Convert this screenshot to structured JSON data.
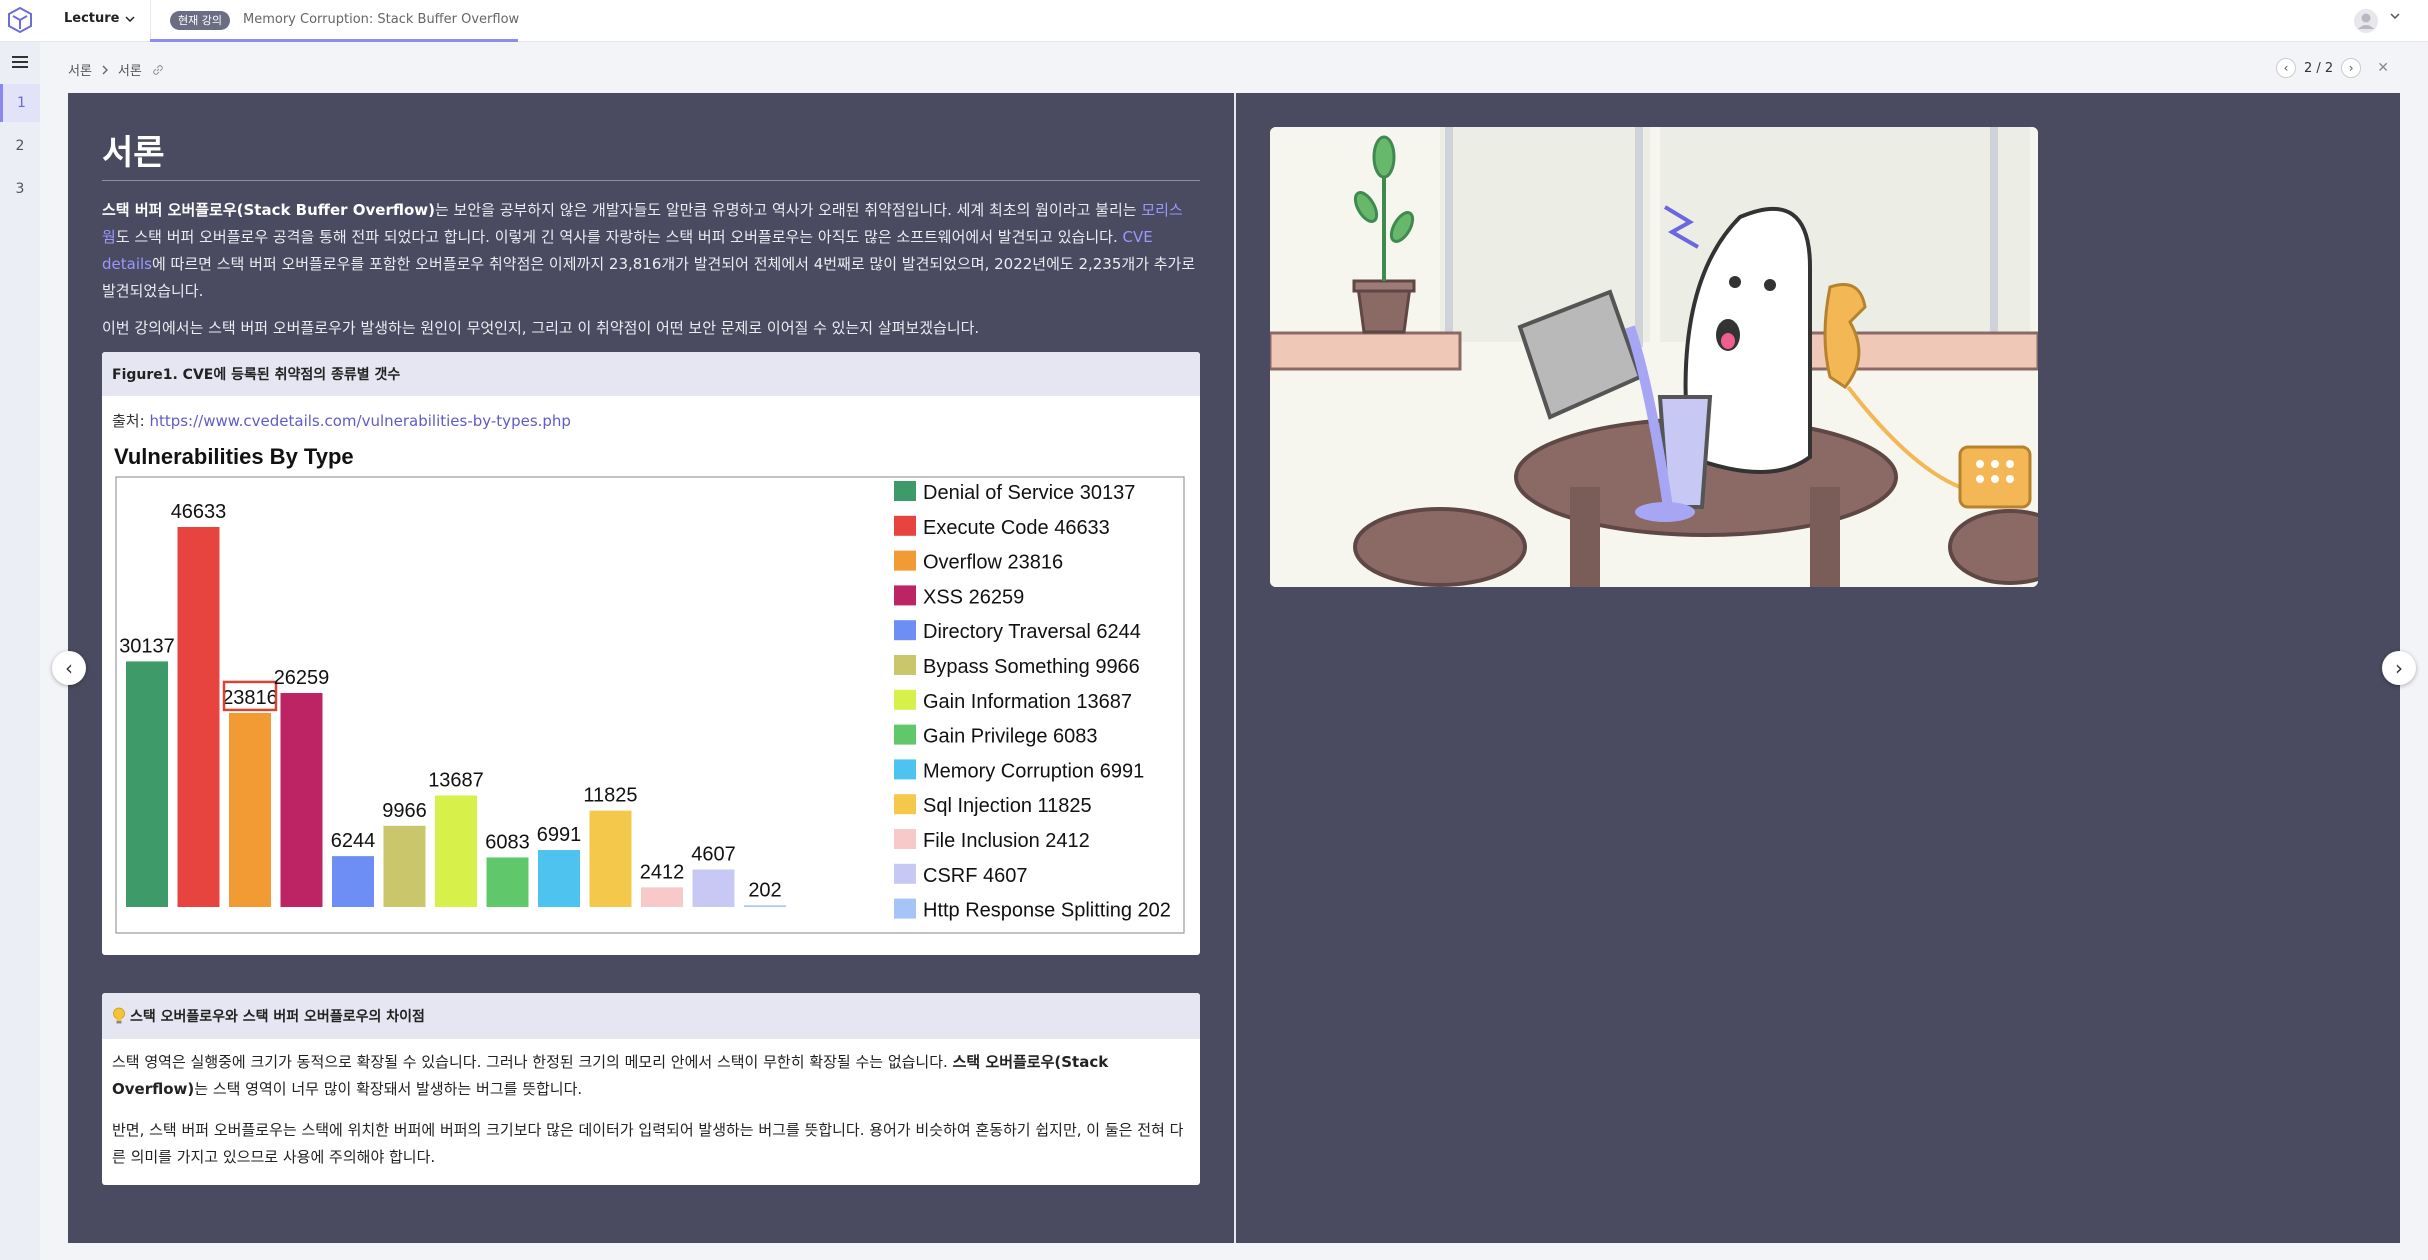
{
  "topbar": {
    "lecture_label": "Lecture",
    "current_badge": "현재 강의",
    "current_title": "Memory Corruption: Stack Buffer Overflow"
  },
  "rail": {
    "items": [
      "1",
      "2",
      "3"
    ],
    "active_index": 0
  },
  "breadcrumb": {
    "parent": "서론",
    "current": "서론"
  },
  "pager": {
    "text": "2 / 2"
  },
  "content": {
    "title": "서론",
    "para1": {
      "bold_term": "스택 버퍼 오버플로우(Stack Buffer Overflow)",
      "text_a": "는 보안을 공부하지 않은 개발자들도 알만큼 유명하고 역사가 오래된 취약점입니다. 세계 최초의 웜이라고 불리는 ",
      "link1": "모리스 웜",
      "text_b": "도 스택 버퍼 오버플로우 공격을 통해 전파 되었다고 합니다. 이렇게 긴 역사를 자랑하는 스택 버퍼 오버플로우는 아직도 많은 소프트웨어에서 발견되고 있습니다. ",
      "link2": "CVE details",
      "text_c": "에 따르면 스택 버퍼 오버플로우를 포함한 오버플로우 취약점은 이제까지 23,816개가 발견되어 전체에서 4번째로 많이 발견되었으며, 2022년에도 2,235개가 추가로 발견되었습니다."
    },
    "para2": "이번 강의에서는 스택 버퍼 오버플로우가 발생하는 원인이 무엇인지, 그리고 이 취약점이 어떤 보안 문제로 이어질 수 있는지 살펴보겠습니다.",
    "figure": {
      "caption": "Figure1. CVE에 등록된 취약점의 종류별 갯수",
      "source_label": "출처: ",
      "source_url": "https://www.cvedetails.com/vulnerabilities-by-types.php"
    },
    "note": {
      "title": "스택 오버플로우와 스택 버퍼 오버플로우의 차이점",
      "p1_text": "스택 영역은 실행중에 크기가 동적으로 확장될 수 있습니다. 그러나 한정된 크기의 메모리 안에서 스택이 무한히 확장될 수는 없습니다. ",
      "p1_bold": "스택 오버플로우(Stack Overflow)",
      "p1_tail": "는 스택 영역이 너무 많이 확장돼서 발생하는 버그를 뜻합니다.",
      "p2": "반면, 스택 버퍼 오버플로우는 스택에 위치한 버퍼에 버퍼의 크기보다 많은 데이터가 입력되어 발생하는 버그를 뜻합니다. 용어가 비슷하여 혼동하기 쉽지만, 이 둘은 전혀 다른 의미를 가지고 있으므로 사용에 주의해야 합니다."
    }
  },
  "chart_data": {
    "type": "bar",
    "title": "Vulnerabilities By Type",
    "xlabel": "",
    "ylabel": "",
    "ylim": [
      0,
      50000
    ],
    "legend_position": "right",
    "highlighted_category": "Overflow",
    "categories": [
      "Denial of Service",
      "Execute Code",
      "Overflow",
      "XSS",
      "Directory Traversal",
      "Bypass Something",
      "Gain Information",
      "Gain Privilege",
      "Memory Corruption",
      "Sql Injection",
      "File Inclusion",
      "CSRF",
      "Http Response Splitting"
    ],
    "values": [
      30137,
      46633,
      23816,
      26259,
      6244,
      9966,
      13687,
      6083,
      6991,
      11825,
      2412,
      4607,
      202
    ],
    "colors": [
      "#3f9a6a",
      "#e8443f",
      "#f29a34",
      "#bd2463",
      "#6d8ef5",
      "#c9c66b",
      "#d7f04a",
      "#60c86a",
      "#4fc3f0",
      "#f4c84a",
      "#f7c9c9",
      "#c8c8f5",
      "#a6c4f5"
    ]
  }
}
